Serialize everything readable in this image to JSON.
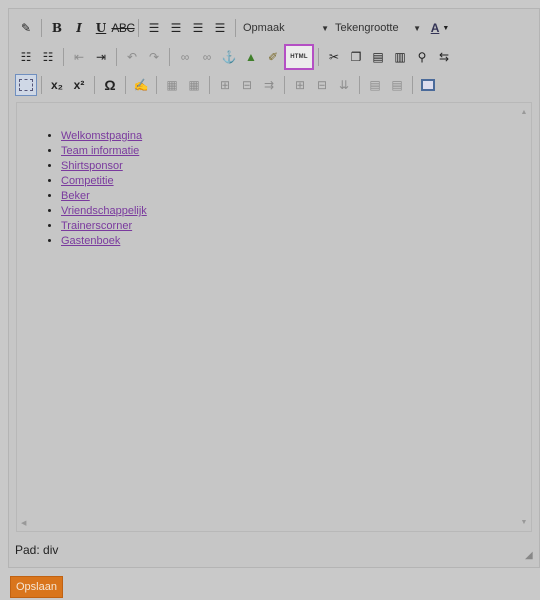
{
  "toolbar": {
    "row1": {
      "bold": "B",
      "italic": "I",
      "underline": "U",
      "strike": "ABC",
      "format_select": "Opmaak",
      "fontsize_select": "Tekengrootte",
      "forecolor": "A"
    },
    "row2": {
      "html_label": "HTML"
    },
    "row3": {
      "subscript": "x₂",
      "superscript": "x²",
      "omega": "Ω"
    }
  },
  "content": {
    "links": [
      "Welkomstpagina",
      "Team informatie",
      "Shirtsponsor",
      "Competitie",
      "Beker",
      "Vriendschappelijk",
      "Trainerscorner",
      "Gastenboek"
    ]
  },
  "status": {
    "path": "Pad: div"
  },
  "save_label": "Opslaan",
  "colors": {
    "html_highlight": "#b44fc4",
    "save_bg": "#d9751c",
    "link": "#7a3a9e"
  }
}
